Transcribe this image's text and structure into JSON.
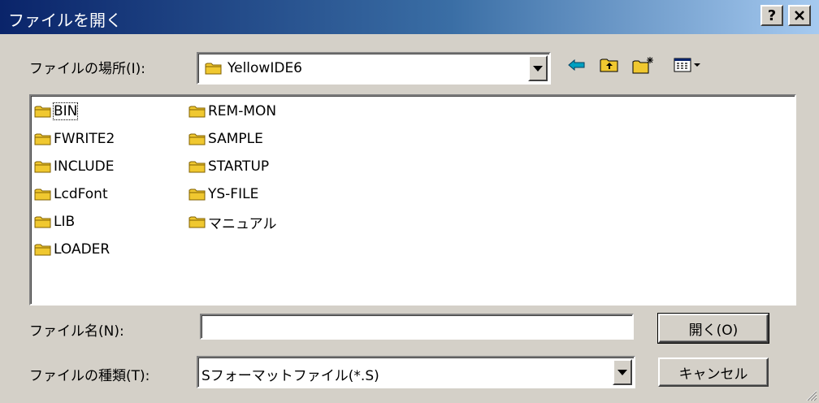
{
  "window": {
    "title": "ファイルを開く",
    "help_button": "?",
    "close_button": "✕"
  },
  "look_in": {
    "label": "ファイルの場所(I):",
    "value": "YellowIDE6"
  },
  "toolbar": {
    "icons": [
      "back-arrow-icon",
      "up-folder-icon",
      "new-folder-icon",
      "view-menu-icon"
    ],
    "accent": "#00a0c0"
  },
  "files": {
    "column1": [
      "BIN",
      "FWRITE2",
      "INCLUDE",
      "LcdFont",
      "LIB",
      "LOADER"
    ],
    "column2": [
      "REM-MON",
      "SAMPLE",
      "STARTUP",
      "YS-FILE",
      "マニュアル"
    ]
  },
  "file_name": {
    "label": "ファイル名(N):",
    "value": ""
  },
  "file_type": {
    "label": "ファイルの種類(T):",
    "value": "Sフォーマットファイル(*.S)"
  },
  "buttons": {
    "open": "開く(O)",
    "cancel": "キャンセル"
  },
  "colors": {
    "titlebar_start": "#0a246a",
    "titlebar_end": "#a6caf0",
    "folder": "#f0c830",
    "face": "#d4d0c8"
  }
}
